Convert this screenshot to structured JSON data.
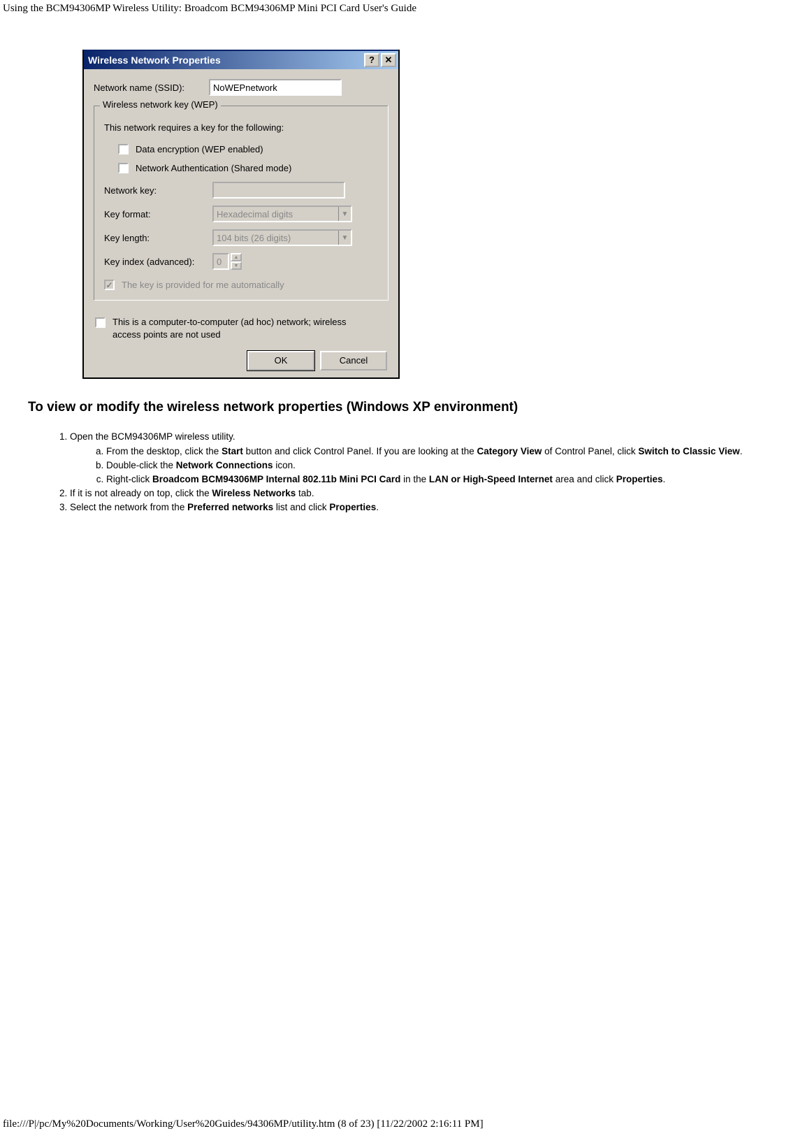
{
  "header": {
    "title": "Using the BCM94306MP Wireless Utility: Broadcom BCM94306MP Mini PCI Card User's Guide"
  },
  "dialog": {
    "title": "Wireless Network Properties",
    "help_btn": "?",
    "close_btn": "✕",
    "ssid_label": "Network name (SSID):",
    "ssid_value": "NoWEPnetwork",
    "group_legend": "Wireless network key (WEP)",
    "group_desc": "This network requires a key for the following:",
    "chk_encrypt": "Data encryption (WEP enabled)",
    "chk_auth": "Network Authentication (Shared mode)",
    "netkey_label": "Network key:",
    "netkey_value": "",
    "keyformat_label": "Key format:",
    "keyformat_value": "Hexadecimal digits",
    "keylength_label": "Key length:",
    "keylength_value": "104 bits (26 digits)",
    "keyindex_label": "Key index (advanced):",
    "keyindex_value": "0",
    "auto_label": "The key is provided for me automatically",
    "adhoc_label": "This is a computer-to-computer (ad hoc) network; wireless access points are not used",
    "ok_btn": "OK",
    "cancel_btn": "Cancel"
  },
  "section": {
    "heading": "To view or modify the wireless network properties (Windows XP environment)",
    "step1": "Open the BCM94306MP wireless utility.",
    "step1a_pre": "From the desktop, click the ",
    "step1a_b1": "Start",
    "step1a_mid1": " button and click Control Panel. If you are looking at the ",
    "step1a_b2": "Category View",
    "step1a_mid2": " of Control Panel, click ",
    "step1a_b3": "Switch to Classic View",
    "step1a_end": ".",
    "step1b_pre": "Double-click the ",
    "step1b_b1": "Network Connections",
    "step1b_end": " icon.",
    "step1c_pre": "Right-click ",
    "step1c_b1": "Broadcom BCM94306MP Internal 802.11b Mini PCI Card",
    "step1c_mid1": " in the ",
    "step1c_b2": "LAN or High-Speed Internet",
    "step1c_mid2": " area and click ",
    "step1c_b3": "Properties",
    "step1c_end": ".",
    "step2_pre": "If it is not already on top, click the ",
    "step2_b1": "Wireless Networks",
    "step2_end": " tab.",
    "step3_pre": "Select the network from the ",
    "step3_b1": "Preferred networks",
    "step3_mid": " list and click ",
    "step3_b2": "Properties",
    "step3_end": "."
  },
  "footer": {
    "text": "file:///P|/pc/My%20Documents/Working/User%20Guides/94306MP/utility.htm (8 of 23) [11/22/2002 2:16:11 PM]"
  }
}
